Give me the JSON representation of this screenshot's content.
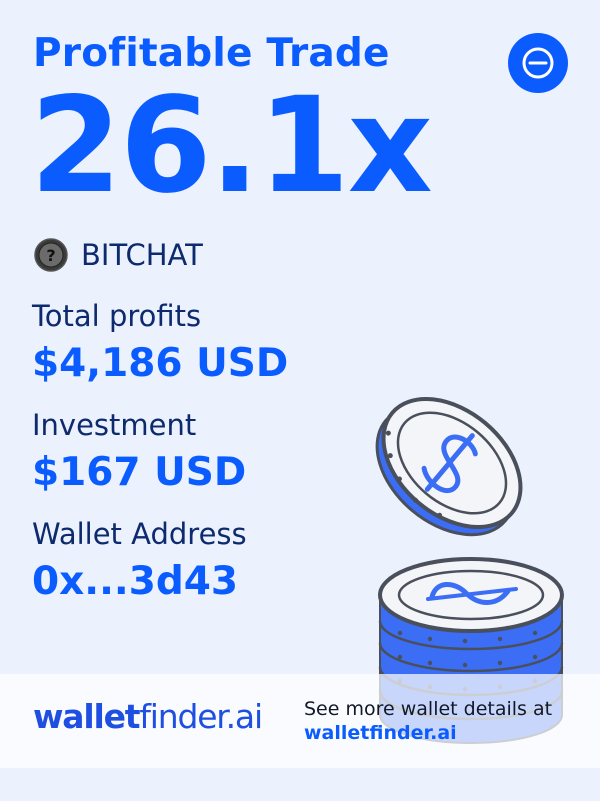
{
  "header": {
    "title": "Profitable Trade",
    "multiplier": "26.1x"
  },
  "token": {
    "icon": "question-mark-coin-icon",
    "name": "BITCHAT"
  },
  "stats": {
    "profits_label": "Total profits",
    "profits_value": "$4,186 USD",
    "investment_label": "Investment",
    "investment_value": "$167 USD",
    "wallet_label": "Wallet Address",
    "wallet_value": "0x...3d43"
  },
  "footer": {
    "brand_bold": "wallet",
    "brand_rest": "finder.ai",
    "cta_text": "See more wallet details at",
    "cta_link": "walletfinder.ai"
  },
  "colors": {
    "background": "#ebf1fd",
    "accent": "#0b5cff",
    "text_dark": "#0d2a6e",
    "coin_blue": "#3b6ef5",
    "coin_outline": "#4a4f5c"
  }
}
